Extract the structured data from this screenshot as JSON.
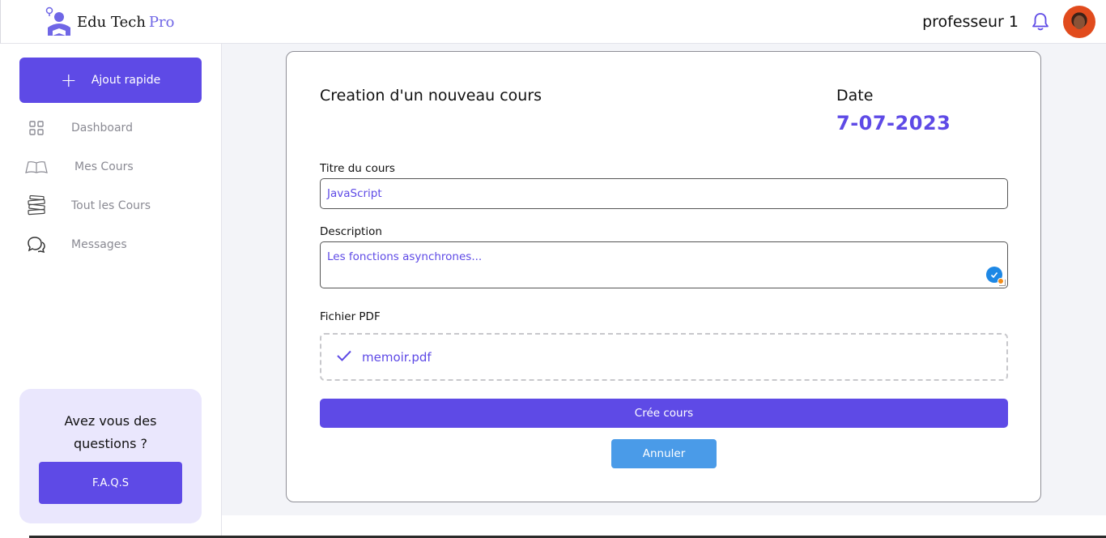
{
  "app": {
    "name": "Edu Tech",
    "name_accent": "Pro",
    "colors": {
      "primary": "#5e4ae6",
      "secondary": "#4a9be8",
      "faq_bg": "#eae7fd"
    }
  },
  "header": {
    "user_name": "professeur 1",
    "icons": [
      "bell-icon",
      "avatar"
    ]
  },
  "sidebar": {
    "quick_add_label": "Ajout rapide",
    "items": [
      {
        "label": "Dashboard",
        "icon": "grid-icon"
      },
      {
        "label": "Mes Cours",
        "icon": "open-book-icon"
      },
      {
        "label": "Tout les Cours",
        "icon": "book-stack-icon"
      },
      {
        "label": "Messages",
        "icon": "chat-icon"
      }
    ],
    "faq": {
      "title": "Avez vous des questions ?",
      "button_label": "F.A.Q.S"
    }
  },
  "form": {
    "title": "Creation d'un nouveau cours",
    "date_label": "Date",
    "date_value": "7-07-2023",
    "course_title_label": "Titre du cours",
    "course_title_value": "JavaScript",
    "description_label": "Description",
    "description_value": "Les fonctions asynchrones...",
    "pdf_label": "Fichier PDF",
    "pdf_file": "memoir.pdf",
    "submit_label": "Crée cours",
    "cancel_label": "Annuler"
  }
}
